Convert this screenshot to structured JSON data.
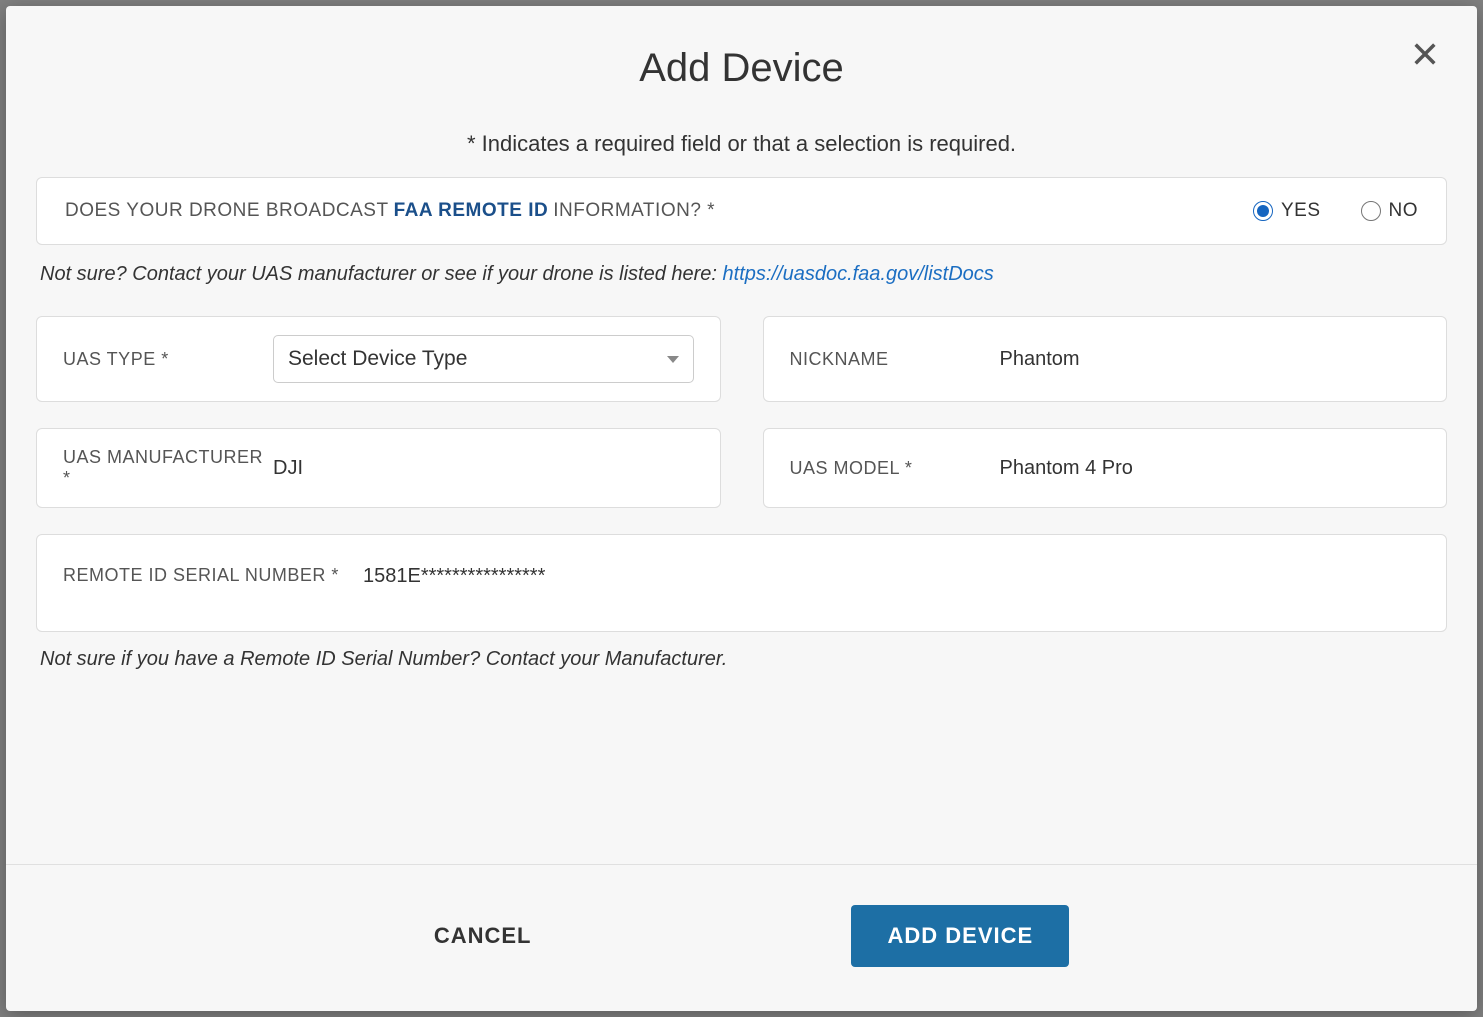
{
  "modal": {
    "title": "Add Device",
    "required_note": "* Indicates a required field or that a selection is required."
  },
  "remote_id_question": {
    "prefix": "DOES YOUR DRONE BROADCAST ",
    "link": "FAA REMOTE ID",
    "suffix": " INFORMATION? *",
    "yes_label": "YES",
    "no_label": "NO",
    "selected": "yes"
  },
  "help_note": {
    "text": "Not sure? Contact your UAS manufacturer or see if your drone is listed here: ",
    "link": "https://uasdoc.faa.gov/listDocs"
  },
  "fields": {
    "uas_type": {
      "label": "UAS TYPE *",
      "placeholder": "Select Device Type"
    },
    "nickname": {
      "label": "NICKNAME",
      "value": "Phantom"
    },
    "manufacturer": {
      "label": "UAS MANUFACTURER *",
      "value": "DJI"
    },
    "model": {
      "label": "UAS MODEL *",
      "value": "Phantom 4 Pro"
    },
    "remote_id_serial": {
      "label": "REMOTE ID SERIAL NUMBER *",
      "value": "1581E****************"
    }
  },
  "serial_note": "Not sure if you have a Remote ID Serial Number? Contact your Manufacturer.",
  "buttons": {
    "cancel": "CANCEL",
    "submit": "ADD DEVICE"
  }
}
